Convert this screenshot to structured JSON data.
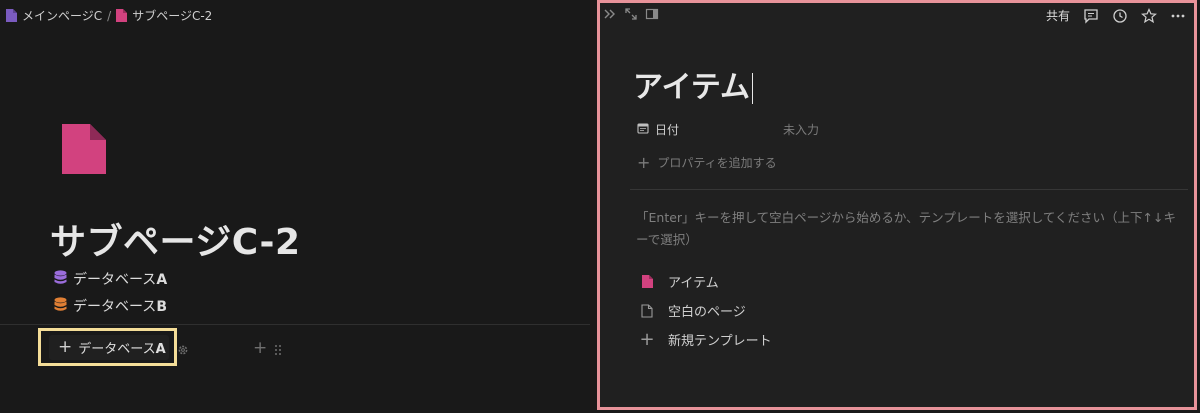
{
  "breadcrumb": {
    "items": [
      {
        "label": "メインページC",
        "icon": "page-icon",
        "color": "#7a5bbf"
      },
      {
        "label": "サブページC-2",
        "icon": "page-icon",
        "color": "#d2427f"
      }
    ],
    "separator": "/"
  },
  "page": {
    "icon": "page-icon",
    "icon_color": "#d2427f",
    "title": "サブページC-2",
    "linked_databases": [
      {
        "label_prefix": "データベース",
        "label_suffix": "A",
        "icon": "database-icon",
        "color": "#9b6ddc"
      },
      {
        "label_prefix": "データベース",
        "label_suffix": "B",
        "icon": "database-icon",
        "color": "#e07f34"
      }
    ]
  },
  "inline_db": {
    "tab_plus": "+",
    "tab_label_prefix": "データベース",
    "tab_label_suffix": "A",
    "add_view": "+"
  },
  "peek": {
    "toolbar": {
      "share_label": "共有"
    },
    "title": "アイテム",
    "property": {
      "name": "日付",
      "icon": "calendar-icon",
      "value_placeholder": "未入力"
    },
    "add_property": {
      "plus": "+",
      "label": "プロパティを追加する"
    },
    "hint": "「Enter」キーを押して空白ページから始めるか、テンプレートを選択してください（上下↑↓キーで選択）",
    "templates": [
      {
        "label": "アイテム",
        "icon": "page-icon",
        "color": "#d2427f"
      },
      {
        "label": "空白のページ",
        "icon": "blank-page-icon",
        "color": "#9a9a9a"
      },
      {
        "label": "新規テンプレート",
        "icon": "plus-icon",
        "plus": "+"
      }
    ]
  },
  "colors": {
    "highlight_left": "#f4dd98",
    "highlight_right": "#e8939a",
    "background": "#191919",
    "peek_background": "#202020"
  }
}
